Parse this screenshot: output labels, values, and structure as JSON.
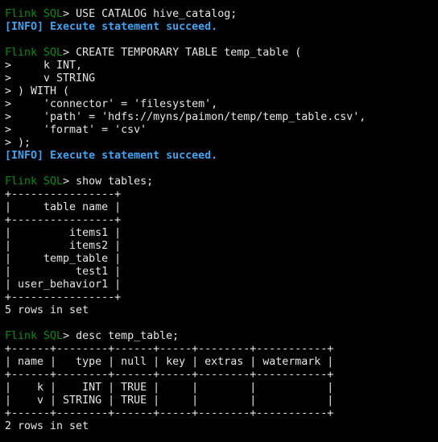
{
  "colors": {
    "background": "#000000",
    "text": "#e6e6e6",
    "prompt": "#0f8a0f",
    "info": "#3fa3f0"
  },
  "lines": [
    {
      "kind": "cmd",
      "prompt": "Flink SQL",
      "text": "> USE CATALOG hive_catalog;"
    },
    {
      "kind": "info",
      "text": "[INFO] Execute statement succeed."
    },
    {
      "kind": "out",
      "text": ""
    },
    {
      "kind": "cmd",
      "prompt": "Flink SQL",
      "text": "> CREATE TEMPORARY TABLE temp_table ("
    },
    {
      "kind": "out",
      "text": ">     k INT,"
    },
    {
      "kind": "out",
      "text": ">     v STRING"
    },
    {
      "kind": "out",
      "text": "> ) WITH ("
    },
    {
      "kind": "out",
      "text": ">     'connector' = 'filesystem',"
    },
    {
      "kind": "out",
      "text": ">     'path' = 'hdfs://myns/paimon/temp/temp_table.csv',"
    },
    {
      "kind": "out",
      "text": ">     'format' = 'csv'"
    },
    {
      "kind": "out",
      "text": "> );"
    },
    {
      "kind": "info",
      "text": "[INFO] Execute statement succeed."
    },
    {
      "kind": "out",
      "text": ""
    },
    {
      "kind": "cmd",
      "prompt": "Flink SQL",
      "text": "> show tables;"
    },
    {
      "kind": "out",
      "text": "+----------------+"
    },
    {
      "kind": "out",
      "text": "|     table name |"
    },
    {
      "kind": "out",
      "text": "+----------------+"
    },
    {
      "kind": "out",
      "text": "|         items1 |"
    },
    {
      "kind": "out",
      "text": "|         items2 |"
    },
    {
      "kind": "out",
      "text": "|     temp_table |"
    },
    {
      "kind": "out",
      "text": "|          test1 |"
    },
    {
      "kind": "out",
      "text": "| user_behavior1 |"
    },
    {
      "kind": "out",
      "text": "+----------------+"
    },
    {
      "kind": "out",
      "text": "5 rows in set"
    },
    {
      "kind": "out",
      "text": ""
    },
    {
      "kind": "cmd",
      "prompt": "Flink SQL",
      "text": "> desc temp_table;"
    },
    {
      "kind": "out",
      "text": "+------+--------+------+-----+--------+-----------+"
    },
    {
      "kind": "out",
      "text": "| name |   type | null | key | extras | watermark |"
    },
    {
      "kind": "out",
      "text": "+------+--------+------+-----+--------+-----------+"
    },
    {
      "kind": "out",
      "text": "|    k |    INT | TRUE |     |        |           |"
    },
    {
      "kind": "out",
      "text": "|    v | STRING | TRUE |     |        |           |"
    },
    {
      "kind": "out",
      "text": "+------+--------+------+-----+--------+-----------+"
    },
    {
      "kind": "out",
      "text": "2 rows in set"
    }
  ]
}
